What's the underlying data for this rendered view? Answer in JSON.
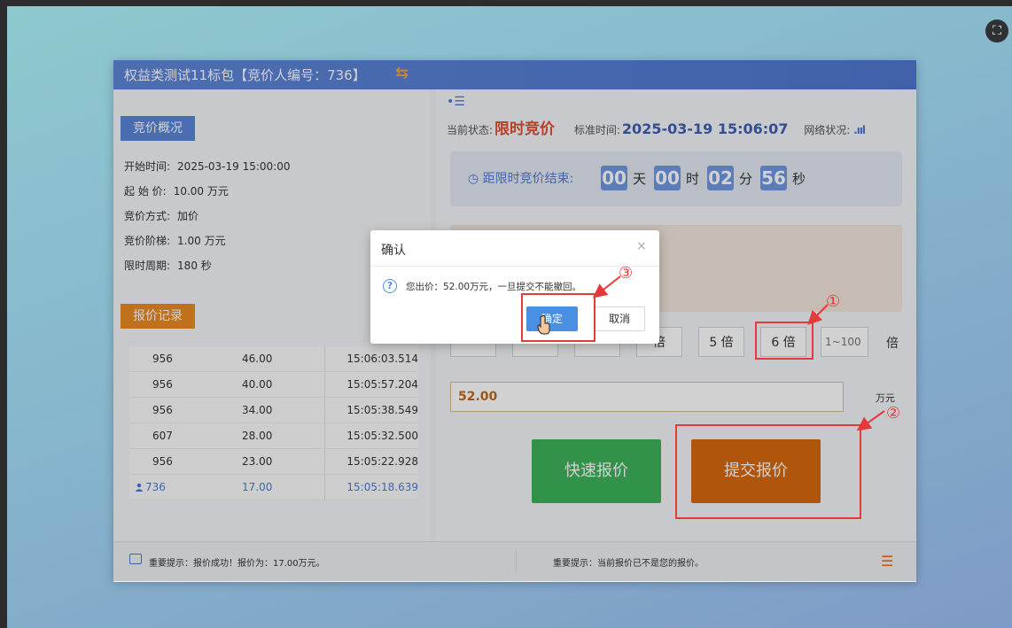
{
  "window": {
    "title": "权益类测试11标包【竞价人编号：736】",
    "swap_icon": "⇆"
  },
  "overview": {
    "label": "竞价概况",
    "rows": [
      {
        "k": "开始时间:",
        "v": "2025-03-19 15:00:00"
      },
      {
        "k": "起 始 价:",
        "v": "10.00 万元"
      },
      {
        "k": "竞价方式:",
        "v": "加价"
      },
      {
        "k": "竞价阶梯:",
        "v": "1.00 万元"
      },
      {
        "k": "限时周期:",
        "v": "180 秒"
      }
    ]
  },
  "records": {
    "label": "报价记录",
    "rows": [
      {
        "id": "956",
        "price": "46.00",
        "time": "15:06:03.514"
      },
      {
        "id": "956",
        "price": "40.00",
        "time": "15:05:57.204"
      },
      {
        "id": "956",
        "price": "34.00",
        "time": "15:05:38.549"
      },
      {
        "id": "607",
        "price": "28.00",
        "time": "15:05:32.500"
      },
      {
        "id": "956",
        "price": "23.00",
        "time": "15:05:22.928"
      },
      {
        "id": "736",
        "price": "17.00",
        "time": "15:05:18.639"
      }
    ]
  },
  "status": {
    "menu_icon": "•☰",
    "state_label": "当前状态:",
    "state_value": "限时竞价",
    "time_label": "标准时间:",
    "time_value": "2025-03-19 15:06:07",
    "network_label": "网络状况:",
    "network_icon": ".ııl"
  },
  "countdown": {
    "label": "◷ 距限时竞价结束:",
    "days": "00",
    "days_unit": "天",
    "hours": "00",
    "hours_unit": "时",
    "minutes": "02",
    "minutes_unit": "分",
    "seconds": "56",
    "seconds_unit": "秒"
  },
  "multipliers": {
    "buttons": [
      "",
      "",
      "",
      "倍",
      "5 倍",
      "6 倍"
    ],
    "range_placeholder": "1~100",
    "unit": "倍"
  },
  "price": {
    "value": "52.00",
    "unit": "万元"
  },
  "actions": {
    "quick": "快速报价",
    "submit": "提交报价"
  },
  "footer": {
    "tip_left": "重要提示：报价成功！报价为：17.00万元。",
    "tip_right": "重要提示：当前报价已不是您的报价。",
    "list_icon": "☰"
  },
  "dialog": {
    "title": "确认",
    "close": "×",
    "message": "您出价：52.00万元，一旦提交不能撤回。",
    "ok": "确定",
    "cancel": "取消"
  },
  "annotations": {
    "n1": "①",
    "n2": "②",
    "n3": "③",
    "color": "#e53a3a"
  },
  "corner_icon": "⛶"
}
